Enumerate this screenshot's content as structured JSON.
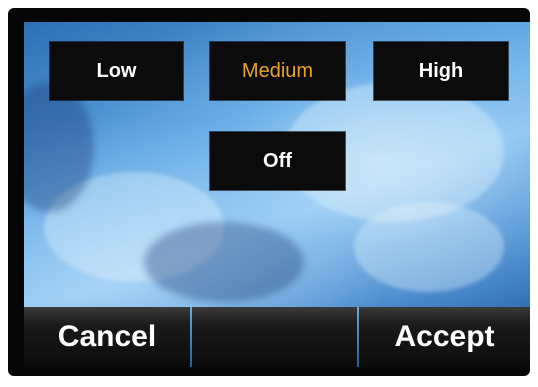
{
  "level_selector": {
    "options": {
      "low": "Low",
      "medium": "Medium",
      "high": "High",
      "off": "Off"
    },
    "selected": "Medium",
    "selected_color": "#e8a52a",
    "default_text_color": "#ffffff"
  },
  "softkeys": {
    "cancel": "Cancel",
    "middle": "",
    "accept": "Accept"
  },
  "colors": {
    "button_background": "#0b0b0b",
    "background_accent": "#5ea6e2"
  }
}
